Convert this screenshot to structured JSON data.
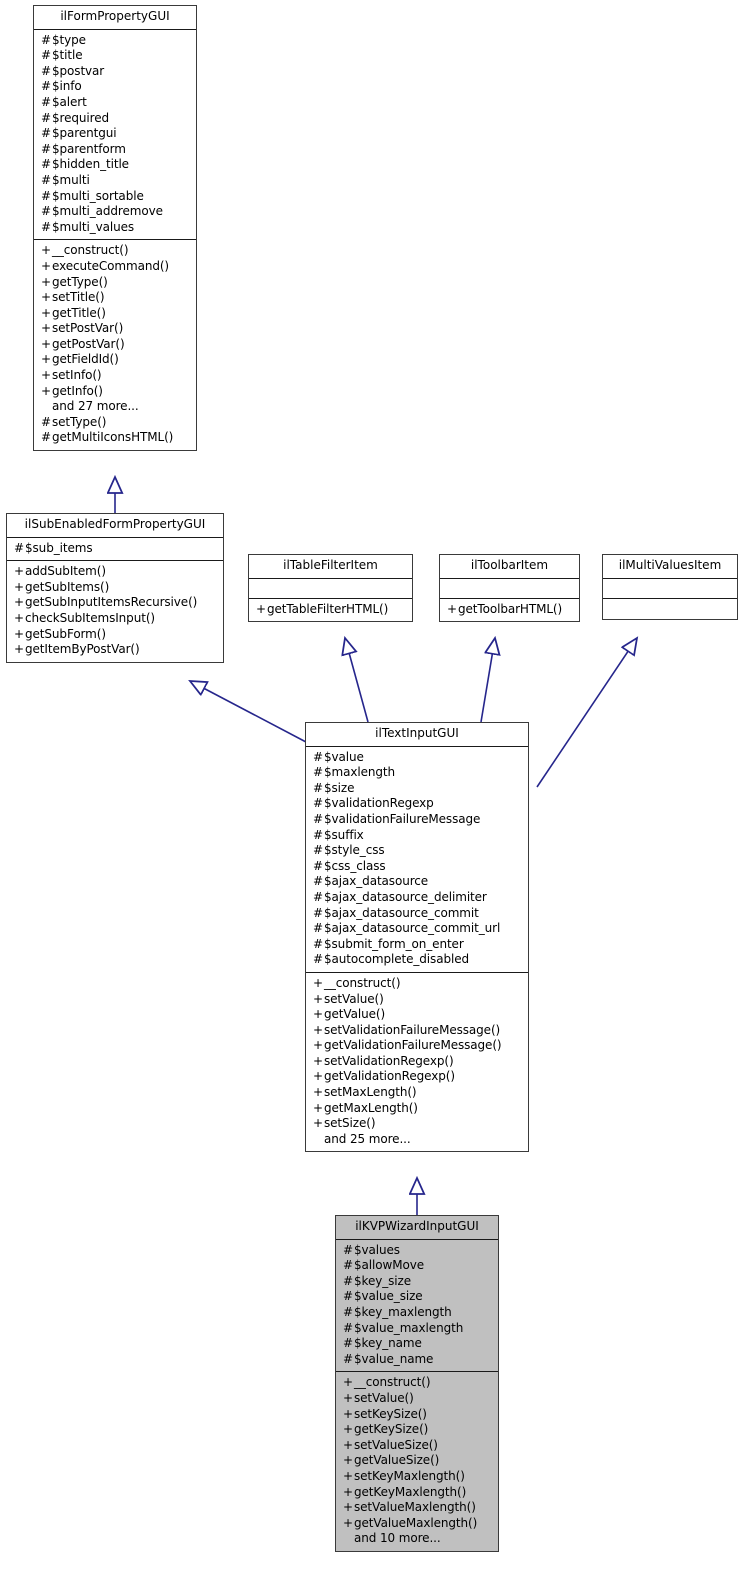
{
  "diagram": {
    "type": "uml-class-inheritance",
    "title": "ilKVPWizardInputGUI inheritance diagram",
    "line_color": "#26268c",
    "box_border_color": "#3a3a3a",
    "highlight_fill": "#c0c0c0"
  },
  "classes": {
    "ilFormPropertyGUI": {
      "name": "ilFormPropertyGUI",
      "attributes": [
        {
          "sym": "#",
          "text": "$type"
        },
        {
          "sym": "#",
          "text": "$title"
        },
        {
          "sym": "#",
          "text": "$postvar"
        },
        {
          "sym": "#",
          "text": "$info"
        },
        {
          "sym": "#",
          "text": "$alert"
        },
        {
          "sym": "#",
          "text": "$required"
        },
        {
          "sym": "#",
          "text": "$parentgui"
        },
        {
          "sym": "#",
          "text": "$parentform"
        },
        {
          "sym": "#",
          "text": "$hidden_title"
        },
        {
          "sym": "#",
          "text": "$multi"
        },
        {
          "sym": "#",
          "text": "$multi_sortable"
        },
        {
          "sym": "#",
          "text": "$multi_addremove"
        },
        {
          "sym": "#",
          "text": "$multi_values"
        }
      ],
      "methods": [
        {
          "sym": "+",
          "text": "__construct()"
        },
        {
          "sym": "+",
          "text": "executeCommand()"
        },
        {
          "sym": "+",
          "text": "getType()"
        },
        {
          "sym": "+",
          "text": "setTitle()"
        },
        {
          "sym": "+",
          "text": "getTitle()"
        },
        {
          "sym": "+",
          "text": "setPostVar()"
        },
        {
          "sym": "+",
          "text": "getPostVar()"
        },
        {
          "sym": "+",
          "text": "getFieldId()"
        },
        {
          "sym": "+",
          "text": "setInfo()"
        },
        {
          "sym": "+",
          "text": "getInfo()"
        },
        {
          "sym": "",
          "text": "and 27 more..."
        },
        {
          "sym": "#",
          "text": "setType()"
        },
        {
          "sym": "#",
          "text": "getMultiIconsHTML()"
        }
      ]
    },
    "ilSubEnabledFormPropertyGUI": {
      "name": "ilSubEnabledFormPropertyGUI",
      "attributes": [
        {
          "sym": "#",
          "text": "$sub_items"
        }
      ],
      "methods": [
        {
          "sym": "+",
          "text": "addSubItem()"
        },
        {
          "sym": "+",
          "text": "getSubItems()"
        },
        {
          "sym": "+",
          "text": "getSubInputItemsRecursive()"
        },
        {
          "sym": "+",
          "text": "checkSubItemsInput()"
        },
        {
          "sym": "+",
          "text": "getSubForm()"
        },
        {
          "sym": "+",
          "text": "getItemByPostVar()"
        }
      ]
    },
    "ilTableFilterItem": {
      "name": "ilTableFilterItem",
      "attributes": [],
      "methods": [
        {
          "sym": "+",
          "text": "getTableFilterHTML()"
        }
      ]
    },
    "ilToolbarItem": {
      "name": "ilToolbarItem",
      "attributes": [],
      "methods": [
        {
          "sym": "+",
          "text": "getToolbarHTML()"
        }
      ]
    },
    "ilMultiValuesItem": {
      "name": "ilMultiValuesItem",
      "attributes": [],
      "methods": []
    },
    "ilTextInputGUI": {
      "name": "ilTextInputGUI",
      "attributes": [
        {
          "sym": "#",
          "text": "$value"
        },
        {
          "sym": "#",
          "text": "$maxlength"
        },
        {
          "sym": "#",
          "text": "$size"
        },
        {
          "sym": "#",
          "text": "$validationRegexp"
        },
        {
          "sym": "#",
          "text": "$validationFailureMessage"
        },
        {
          "sym": "#",
          "text": "$suffix"
        },
        {
          "sym": "#",
          "text": "$style_css"
        },
        {
          "sym": "#",
          "text": "$css_class"
        },
        {
          "sym": "#",
          "text": "$ajax_datasource"
        },
        {
          "sym": "#",
          "text": "$ajax_datasource_delimiter"
        },
        {
          "sym": "#",
          "text": "$ajax_datasource_commit"
        },
        {
          "sym": "#",
          "text": "$ajax_datasource_commit_url"
        },
        {
          "sym": "#",
          "text": "$submit_form_on_enter"
        },
        {
          "sym": "#",
          "text": "$autocomplete_disabled"
        }
      ],
      "methods": [
        {
          "sym": "+",
          "text": "__construct()"
        },
        {
          "sym": "+",
          "text": "setValue()"
        },
        {
          "sym": "+",
          "text": "getValue()"
        },
        {
          "sym": "+",
          "text": "setValidationFailureMessage()"
        },
        {
          "sym": "+",
          "text": "getValidationFailureMessage()"
        },
        {
          "sym": "+",
          "text": "setValidationRegexp()"
        },
        {
          "sym": "+",
          "text": "getValidationRegexp()"
        },
        {
          "sym": "+",
          "text": "setMaxLength()"
        },
        {
          "sym": "+",
          "text": "getMaxLength()"
        },
        {
          "sym": "+",
          "text": "setSize()"
        },
        {
          "sym": "",
          "text": "and 25 more..."
        }
      ]
    },
    "ilKVPWizardInputGUI": {
      "name": "ilKVPWizardInputGUI",
      "attributes": [
        {
          "sym": "#",
          "text": "$values"
        },
        {
          "sym": "#",
          "text": "$allowMove"
        },
        {
          "sym": "#",
          "text": "$key_size"
        },
        {
          "sym": "#",
          "text": "$value_size"
        },
        {
          "sym": "#",
          "text": "$key_maxlength"
        },
        {
          "sym": "#",
          "text": "$value_maxlength"
        },
        {
          "sym": "#",
          "text": "$key_name"
        },
        {
          "sym": "#",
          "text": "$value_name"
        }
      ],
      "methods": [
        {
          "sym": "+",
          "text": "__construct()"
        },
        {
          "sym": "+",
          "text": "setValue()"
        },
        {
          "sym": "+",
          "text": "setKeySize()"
        },
        {
          "sym": "+",
          "text": "getKeySize()"
        },
        {
          "sym": "+",
          "text": "setValueSize()"
        },
        {
          "sym": "+",
          "text": "getValueSize()"
        },
        {
          "sym": "+",
          "text": "setKeyMaxlength()"
        },
        {
          "sym": "+",
          "text": "getKeyMaxlength()"
        },
        {
          "sym": "+",
          "text": "setValueMaxlength()"
        },
        {
          "sym": "+",
          "text": "getValueMaxlength()"
        },
        {
          "sym": "",
          "text": "and 10 more..."
        }
      ]
    }
  },
  "relations": [
    {
      "from": "ilSubEnabledFormPropertyGUI",
      "to": "ilFormPropertyGUI",
      "kind": "generalization"
    },
    {
      "from": "ilTextInputGUI",
      "to": "ilSubEnabledFormPropertyGUI",
      "kind": "generalization"
    },
    {
      "from": "ilTextInputGUI",
      "to": "ilTableFilterItem",
      "kind": "generalization"
    },
    {
      "from": "ilTextInputGUI",
      "to": "ilToolbarItem",
      "kind": "generalization"
    },
    {
      "from": "ilTextInputGUI",
      "to": "ilMultiValuesItem",
      "kind": "generalization"
    },
    {
      "from": "ilKVPWizardInputGUI",
      "to": "ilTextInputGUI",
      "kind": "generalization"
    }
  ]
}
